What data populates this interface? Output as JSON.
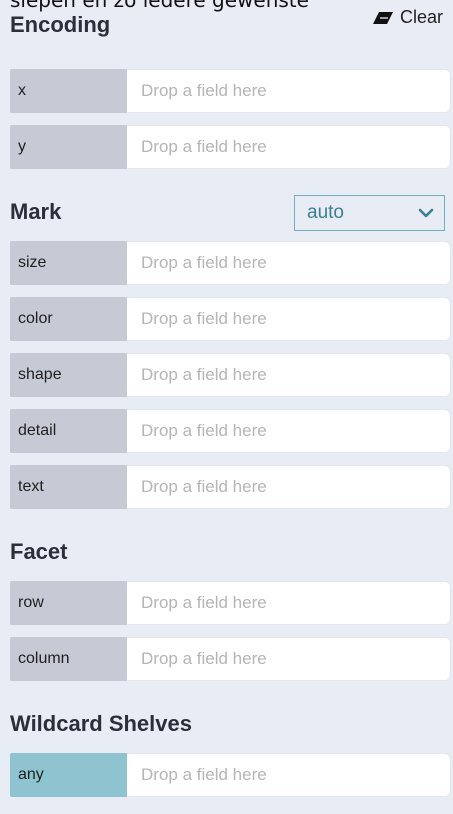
{
  "topline_text": "slepen en zo iedere gewenste",
  "encoding": {
    "title": "Encoding",
    "clear_label": "Clear",
    "shelves": [
      {
        "label": "x",
        "placeholder": "Drop a field here"
      },
      {
        "label": "y",
        "placeholder": "Drop a field here"
      }
    ]
  },
  "mark": {
    "title": "Mark",
    "select_value": "auto",
    "shelves": [
      {
        "label": "size",
        "placeholder": "Drop a field here"
      },
      {
        "label": "color",
        "placeholder": "Drop a field here"
      },
      {
        "label": "shape",
        "placeholder": "Drop a field here"
      },
      {
        "label": "detail",
        "placeholder": "Drop a field here"
      },
      {
        "label": "text",
        "placeholder": "Drop a field here"
      }
    ]
  },
  "facet": {
    "title": "Facet",
    "shelves": [
      {
        "label": "row",
        "placeholder": "Drop a field here"
      },
      {
        "label": "column",
        "placeholder": "Drop a field here"
      }
    ]
  },
  "wildcard": {
    "title": "Wildcard Shelves",
    "shelves": [
      {
        "label": "any",
        "placeholder": "Drop a field here"
      }
    ]
  },
  "colors": {
    "panel_bg": "#e8ecf4",
    "label_bg": "#c6cad4",
    "wildcard_label_bg": "#8ec4cf",
    "accent": "#6fb1c1"
  },
  "icons": {
    "clear": "eraser-icon",
    "select": "chevron-down-icon"
  }
}
